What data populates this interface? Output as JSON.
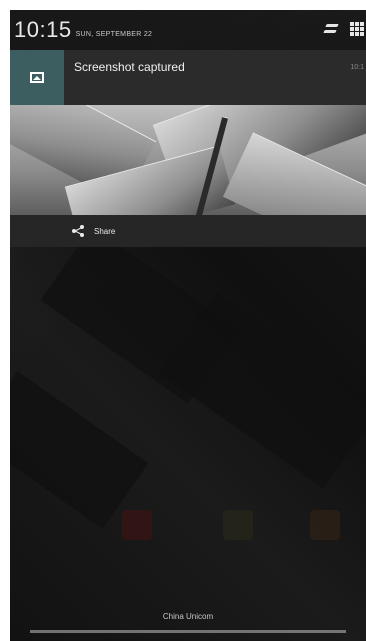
{
  "status_bar": {
    "time": "10:15",
    "date": "SUN, SEPTEMBER 22"
  },
  "notification": {
    "title": "Screenshot captured",
    "time": "10:1",
    "icon": "image-icon"
  },
  "actions": {
    "share_label": "Share",
    "share_icon": "share-icon"
  },
  "footer": {
    "carrier": "China Unicom"
  }
}
